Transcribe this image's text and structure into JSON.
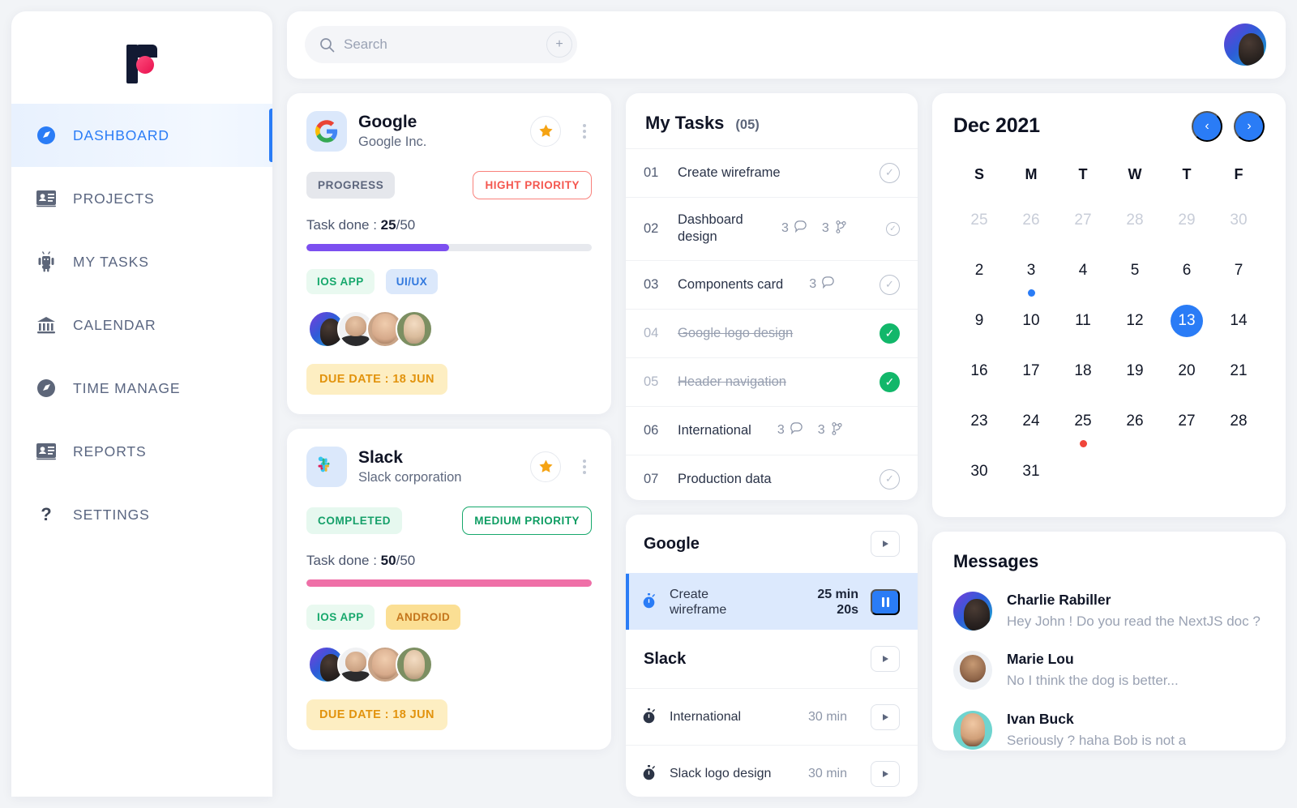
{
  "brand": {
    "logo_name": "pulse-logo"
  },
  "sidebar": {
    "items": [
      {
        "label": "DASHBOARD",
        "icon": "compass-icon",
        "glyph": "🧭",
        "active": true
      },
      {
        "label": "PROJECTS",
        "icon": "id-card-icon",
        "glyph": "🪪",
        "active": false
      },
      {
        "label": "MY TASKS",
        "icon": "android-robot-icon",
        "glyph": "🤖",
        "active": false
      },
      {
        "label": "CALENDAR",
        "icon": "bank-building-icon",
        "glyph": "🏛",
        "active": false
      },
      {
        "label": "TIME MANAGE",
        "icon": "compass-dark-icon",
        "glyph": "🧭",
        "active": false
      },
      {
        "label": "REPORTS",
        "icon": "id-card-icon",
        "glyph": "🪪",
        "active": false
      },
      {
        "label": "SETTINGS",
        "icon": "question-mark-icon",
        "glyph": "❓",
        "active": false
      }
    ]
  },
  "topbar": {
    "search_placeholder": "Search",
    "search_value": "",
    "add_label": "+",
    "avatar_name": "user-avatar"
  },
  "projects": [
    {
      "name": "Google",
      "company": "Google Inc.",
      "logo": "google-logo",
      "status": "PROGRESS",
      "status_kind": "progress",
      "priority": "HIGHT PRIORITY",
      "priority_kind": "high",
      "task_done_label": "Task done : ",
      "done": "25",
      "total": "/50",
      "progress_percent": 50,
      "progress_color": "#7c4ff0",
      "tags": [
        {
          "label": "IOS APP",
          "kind": "ios"
        },
        {
          "label": "UI/UX",
          "kind": "uiux"
        }
      ],
      "due": "DUE DATE : 18 JUN",
      "starred": true
    },
    {
      "name": "Slack",
      "company": "Slack corporation",
      "logo": "slack-logo",
      "status": "COMPLETED",
      "status_kind": "completed",
      "priority": "MEDIUM PRIORITY",
      "priority_kind": "medium",
      "task_done_label": "Task done : ",
      "done": "50",
      "total": "/50",
      "progress_percent": 100,
      "progress_color": "#ef6fa7",
      "tags": [
        {
          "label": "IOS APP",
          "kind": "ios"
        },
        {
          "label": "ANDROID",
          "kind": "android"
        }
      ],
      "due": "DUE DATE : 18 JUN",
      "starred": true
    }
  ],
  "my_tasks": {
    "title": "My Tasks",
    "count": "(05)",
    "rows": [
      {
        "num": "01",
        "name": "Create wireframe",
        "comments": "",
        "branches": "",
        "state": "open",
        "tall": false
      },
      {
        "num": "02",
        "name": "Dashboard design",
        "comments": "3",
        "branches": "3",
        "state": "open-small",
        "tall": true
      },
      {
        "num": "03",
        "name": "Components card",
        "comments": "3",
        "branches": "",
        "state": "open",
        "tall": false
      },
      {
        "num": "04",
        "name": "Google logo design",
        "comments": "",
        "branches": "",
        "state": "done",
        "tall": false
      },
      {
        "num": "05",
        "name": "Header navigation",
        "comments": "",
        "branches": "",
        "state": "done",
        "tall": false
      },
      {
        "num": "06",
        "name": "International",
        "comments": "3",
        "branches": "3",
        "state": "none",
        "tall": false
      },
      {
        "num": "07",
        "name": "Production data",
        "comments": "",
        "branches": "",
        "state": "open",
        "tall": false
      }
    ]
  },
  "timers": {
    "groups": [
      {
        "name": "Google",
        "rows": [
          {
            "name": "Create wireframe",
            "time": "25 min 20s",
            "time_line1": "25 min",
            "time_line2": "20s",
            "active": true,
            "control": "pause"
          }
        ]
      },
      {
        "name": "Slack",
        "rows": [
          {
            "name": "International",
            "time": "30 min",
            "time_line1": "30 min",
            "time_line2": "",
            "active": false,
            "control": "play"
          },
          {
            "name": "Slack logo design",
            "time": "30 min",
            "time_line1": "30 min",
            "time_line2": "",
            "active": false,
            "control": "play"
          }
        ]
      }
    ]
  },
  "calendar": {
    "title": "Dec 2021",
    "prev_icon": "chevron-left-icon",
    "next_icon": "chevron-right-icon",
    "dow": [
      "S",
      "M",
      "T",
      "W",
      "T",
      "F"
    ],
    "cells": [
      {
        "d": "25",
        "muted": true,
        "today": false,
        "dot": "none"
      },
      {
        "d": "26",
        "muted": true,
        "today": false,
        "dot": "none"
      },
      {
        "d": "27",
        "muted": true,
        "today": false,
        "dot": "none"
      },
      {
        "d": "28",
        "muted": true,
        "today": false,
        "dot": "none"
      },
      {
        "d": "29",
        "muted": true,
        "today": false,
        "dot": "none"
      },
      {
        "d": "30",
        "muted": true,
        "today": false,
        "dot": "none"
      },
      {
        "d": "2",
        "muted": false,
        "today": false,
        "dot": "none"
      },
      {
        "d": "3",
        "muted": false,
        "today": false,
        "dot": "blue"
      },
      {
        "d": "4",
        "muted": false,
        "today": false,
        "dot": "none"
      },
      {
        "d": "5",
        "muted": false,
        "today": false,
        "dot": "none"
      },
      {
        "d": "6",
        "muted": false,
        "today": false,
        "dot": "none"
      },
      {
        "d": "7",
        "muted": false,
        "today": false,
        "dot": "none"
      },
      {
        "d": "9",
        "muted": false,
        "today": false,
        "dot": "none"
      },
      {
        "d": "10",
        "muted": false,
        "today": false,
        "dot": "none"
      },
      {
        "d": "11",
        "muted": false,
        "today": false,
        "dot": "none"
      },
      {
        "d": "12",
        "muted": false,
        "today": false,
        "dot": "none"
      },
      {
        "d": "13",
        "muted": false,
        "today": true,
        "dot": "none"
      },
      {
        "d": "14",
        "muted": false,
        "today": false,
        "dot": "none"
      },
      {
        "d": "16",
        "muted": false,
        "today": false,
        "dot": "none"
      },
      {
        "d": "17",
        "muted": false,
        "today": false,
        "dot": "none"
      },
      {
        "d": "18",
        "muted": false,
        "today": false,
        "dot": "none"
      },
      {
        "d": "19",
        "muted": false,
        "today": false,
        "dot": "none"
      },
      {
        "d": "20",
        "muted": false,
        "today": false,
        "dot": "none"
      },
      {
        "d": "21",
        "muted": false,
        "today": false,
        "dot": "none"
      },
      {
        "d": "23",
        "muted": false,
        "today": false,
        "dot": "none"
      },
      {
        "d": "24",
        "muted": false,
        "today": false,
        "dot": "none"
      },
      {
        "d": "25",
        "muted": false,
        "today": false,
        "dot": "red"
      },
      {
        "d": "26",
        "muted": false,
        "today": false,
        "dot": "none"
      },
      {
        "d": "27",
        "muted": false,
        "today": false,
        "dot": "none"
      },
      {
        "d": "28",
        "muted": false,
        "today": false,
        "dot": "none"
      },
      {
        "d": "30",
        "muted": false,
        "today": false,
        "dot": "none"
      },
      {
        "d": "31",
        "muted": false,
        "today": false,
        "dot": "none"
      },
      {
        "d": "",
        "muted": false,
        "today": false,
        "dot": "none"
      },
      {
        "d": "",
        "muted": false,
        "today": false,
        "dot": "none"
      },
      {
        "d": "",
        "muted": false,
        "today": false,
        "dot": "none"
      },
      {
        "d": "",
        "muted": false,
        "today": false,
        "dot": "none"
      }
    ]
  },
  "messages": {
    "title": "Messages",
    "rows": [
      {
        "name": "Charlie Rabiller",
        "text": "Hey John ! Do you read the NextJS doc ?",
        "avatar": "m1"
      },
      {
        "name": "Marie Lou",
        "text": "No I think the dog is better...",
        "avatar": "m2"
      },
      {
        "name": "Ivan Buck",
        "text": "Seriously ? haha Bob is not a",
        "avatar": "m3"
      }
    ]
  },
  "colors": {
    "accent": "#2a7cf6",
    "purple": "#7c4ff0",
    "pink": "#ef6fa7",
    "green": "#12b76a",
    "red": "#f0453a",
    "amber": "#e2930d"
  }
}
